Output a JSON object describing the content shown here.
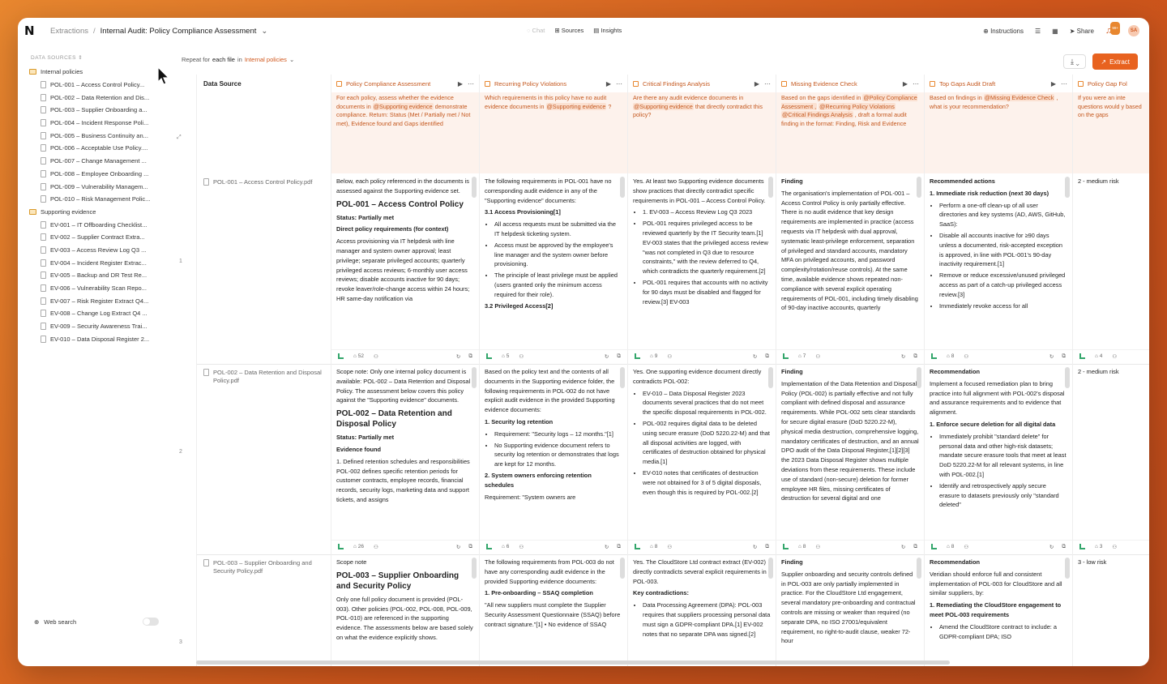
{
  "app": {
    "logo": "N"
  },
  "breadcrumb": {
    "root": "Extractions",
    "separator": "/",
    "current": "Internal Audit: Policy Compliance Assessment"
  },
  "center_nav": {
    "chat": "Chat",
    "sources": "Sources",
    "insights": "Insights"
  },
  "right_nav": {
    "instructions": "Instructions",
    "share": "Share",
    "notifications": "99+",
    "avatar": "SA"
  },
  "sidebar": {
    "heading": "DATA SOURCES",
    "folders": [
      {
        "name": "Internal policies",
        "files": [
          "POL-001 – Access Control Policy...",
          "POL-002 – Data Retention and Dis...",
          "POL-003 – Supplier Onboarding a...",
          "POL-004 – Incident Response Poli...",
          "POL-005 – Business Continuity an...",
          "POL-006 – Acceptable Use Policy....",
          "POL-007 – Change Management ...",
          "POL-008 – Employee Onboarding ...",
          "POL-009 – Vulnerability Managem...",
          "POL-010 – Risk Management Polic..."
        ]
      },
      {
        "name": "Supporting evidence",
        "files": [
          "EV-001 – IT Offboarding Checklist...",
          "EV-002 – Supplier Contract Extra...",
          "EV-003 – Access Review Log Q3 ...",
          "EV-004 – Incident Register Extrac...",
          "EV-005 – Backup and DR Test Re...",
          "EV-006 – Vulnerability Scan Repo...",
          "EV-007 – Risk Register Extract Q4...",
          "EV-008 – Change Log Extract Q4 ...",
          "EV-009 – Security Awareness Trai...",
          "EV-010 – Data Disposal Register 2..."
        ]
      }
    ],
    "web_search": "Web search"
  },
  "toolbar": {
    "repeat_prefix": "Repeat for",
    "repeat_mid": "each file",
    "repeat_in": "in",
    "repeat_target": "Internal policies",
    "extract": "Extract"
  },
  "table": {
    "ds_header": "Data Source",
    "columns": [
      {
        "title": "Policy Compliance Assessment",
        "prompt_pre": "For each policy, assess whether the evidence documents in ",
        "tags": [
          "@Supporting evidence"
        ],
        "prompt_post": " demonstrate compliance. Return: Status (Met / Partially met / Not met), Evidence found and Gaps identified"
      },
      {
        "title": "Recurring Policy Violations",
        "prompt_pre": "Which requirements in this policy have no audit evidence documents in ",
        "tags": [
          "@Supporting evidence"
        ],
        "prompt_post": " ?"
      },
      {
        "title": "Critical Findings Analysis",
        "prompt_pre": "Are there any audit evidence documents in ",
        "tags": [
          "@Supporting evidence"
        ],
        "prompt_post": " that directly contradict this policy?"
      },
      {
        "title": "Missing Evidence Check",
        "prompt_pre": "Based on the gaps identified in ",
        "tags": [
          "@Policy Compliance Assessment ,",
          "@Recurring Policy Violations",
          "@Critical Findings Analysis"
        ],
        "prompt_post": ", draft a formal audit finding in the format: Finding, Risk and Evidence"
      },
      {
        "title": "Top Gaps Audit Draft",
        "prompt_pre": "Based on findings in ",
        "tags": [
          "@Missing Evidence Check"
        ],
        "prompt_post": ", what is your recommendation?"
      },
      {
        "title": "Policy Gap Fol",
        "prompt_pre": "If you were an inte questions would y based on the gaps",
        "tags": [],
        "prompt_post": ""
      }
    ],
    "rows": [
      {
        "num": "1",
        "source": "POL-001 – Access Control Policy.pdf",
        "footer_counts": [
          "52",
          "5",
          "9",
          "7",
          "8",
          "4"
        ],
        "cells": [
          {
            "intro": "Below, each policy referenced in the documents is assessed against the Supporting evidence set.",
            "heading": "POL-001 – Access Control Policy",
            "status": "Status: Partially met",
            "sub": "Direct policy requirements (for context)",
            "body": "Access provisioning via IT helpdesk with line manager and system owner approval; least privilege; separate privileged accounts; quarterly privileged access reviews; 6-monthly user access reviews; disable accounts inactive for 90 days; revoke leaver/role-change access within 24 hours; HR same-day notification via"
          },
          {
            "intro": "The following requirements in POL-001 have no corresponding audit evidence in any of the \"Supporting evidence\" documents:",
            "sub": "3.1 Access Provisioning[1]",
            "items": [
              "All access requests must be submitted via the IT helpdesk ticketing system.",
              "Access must be approved by the employee's line manager and the system owner before provisioning.",
              "The principle of least privilege must be applied (users granted only the minimum access required for their role)."
            ],
            "tail": "3.2 Privileged Access[2]"
          },
          {
            "intro": "Yes. At least two Supporting evidence documents show practices that directly contradict specific requirements in POL-001 – Access Control Policy.",
            "items": [
              "1. EV-003 – Access Review Log Q3 2023",
              "POL-001 requires privileged access to be reviewed quarterly by the IT Security team.[1] EV-003 states that the privileged access review \"was not completed in Q3 due to resource constraints,\" with the review deferred to Q4, which contradicts the quarterly requirement.[2]",
              "POL-001 requires that accounts with no activity for 90 days must be disabled and flagged for review.[3] EV-003"
            ]
          },
          {
            "sub": "Finding",
            "body": "The organisation's implementation of POL-001 – Access Control Policy is only partially effective. There is no audit evidence that key design requirements are implemented in practice (access requests via IT helpdesk with dual approval, systematic least-privilege enforcement, separation of privileged and standard accounts, mandatory MFA on privileged accounts, and password complexity/rotation/reuse controls). At the same time, available evidence shows repeated non-compliance with several explicit operating requirements of POL-001, including timely disabling of 90-day inactive accounts, quarterly"
          },
          {
            "sub": "Recommended actions",
            "heading2": "1. Immediate risk reduction (next 30 days)",
            "items": [
              "Perform a one-off clean-up of all user directories and key systems (AD, AWS, GitHub, SaaS):",
              "Disable all accounts inactive for ≥90 days unless a documented, risk-accepted exception is approved, in line with POL-001's 90-day inactivity requirement.[1]",
              "Remove or reduce excessive/unused privileged access as part of a catch-up privileged access review.[3]",
              "Immediately revoke access for all"
            ]
          },
          {
            "body": "2 - medium risk"
          }
        ]
      },
      {
        "num": "2",
        "source": "POL-002 – Data Retention and Disposal Policy.pdf",
        "footer_counts": [
          "26",
          "6",
          "8",
          "8",
          "8",
          "3"
        ],
        "cells": [
          {
            "intro": "Scope note: Only one internal policy document is available: POL-002 – Data Retention and Disposal Policy. The assessment below covers this policy against the \"Supporting evidence\" documents.",
            "heading": "POL-002 – Data Retention and Disposal Policy",
            "status": "Status: Partially met",
            "sub": "Evidence found",
            "body": "1. Defined retention schedules and responsibilities POL-002 defines specific retention periods for customer contracts, employee records, financial records, security logs, marketing data and support tickets, and assigns"
          },
          {
            "intro": "Based on the policy text and the contents of all documents in the Supporting evidence folder, the following requirements in POL-002 do not have explicit audit evidence in the provided Supporting evidence documents:",
            "sub": "1. Security log retention",
            "items": [
              "Requirement: \"Security logs – 12 months.\"[1]",
              "No Supporting evidence document refers to security log retention or demonstrates that logs are kept for 12 months."
            ],
            "tail": "2. System owners enforcing retention schedules",
            "tail2": "Requirement: \"System owners are"
          },
          {
            "intro": "Yes. One supporting evidence document directly contradicts POL-002:",
            "items": [
              "EV-010 – Data Disposal Register 2023 documents several practices that do not meet the specific disposal requirements in POL-002.",
              "POL-002 requires digital data to be deleted using secure erasure (DoD 5220.22-M) and that all disposal activities are logged, with certificates of destruction obtained for physical media.[1]",
              "EV-010 notes that certificates of destruction were not obtained for 3 of 5 digital disposals, even though this is required by POL-002.[2]"
            ]
          },
          {
            "sub": "Finding",
            "body": "Implementation of the Data Retention and Disposal Policy (POL-002) is partially effective and not fully compliant with defined disposal and assurance requirements. While POL-002 sets clear standards for secure digital erasure (DoD 5220.22-M), physical media destruction, comprehensive logging, mandatory certificates of destruction, and an annual DPO audit of the Data Disposal Register,[1][2][3] the 2023 Data Disposal Register shows multiple deviations from these requirements. These include use of standard (non-secure) deletion for former employee HR files, missing certificates of destruction for several digital and one"
          },
          {
            "sub": "Recommendation",
            "body": "Implement a focused remediation plan to bring practice into full alignment with POL-002's disposal and assurance requirements and to evidence that alignment.",
            "heading2": "1. Enforce secure deletion for all digital data",
            "items": [
              "Immediately prohibit \"standard delete\" for personal data and other high-risk datasets; mandate secure erasure tools that meet at least DoD 5220.22-M for all relevant systems, in line with POL-002.[1]",
              "Identify and retrospectively apply secure erasure to datasets previously only \"standard deleted\""
            ]
          },
          {
            "body": "2 - medium risk"
          }
        ]
      },
      {
        "num": "3",
        "source": "POL-003 – Supplier Onboarding and Security Policy.pdf",
        "footer_counts": [],
        "cells": [
          {
            "intro": "Scope note",
            "body": "Only one full policy document is provided (POL-003). Other policies (POL-002, POL-008, POL-009, POL-010) are referenced in the supporting evidence. The assessments below are based solely on what the evidence explicitly shows.",
            "heading": "POL-003 – Supplier Onboarding and Security Policy"
          },
          {
            "intro": "The following requirements from POL-003 do not have any corresponding audit evidence in the provided Supporting evidence documents:",
            "sub": "1. Pre-onboarding – SSAQ completion",
            "body": "\"All new suppliers must complete the Supplier Security Assessment Questionnaire (SSAQ) before contract signature.\"[1] • No evidence of SSAQ"
          },
          {
            "intro": "Yes. The CloudStore Ltd contract extract (EV-002) directly contradicts several explicit requirements in POL-003.",
            "sub": "Key contradictions:",
            "items": [
              "Data Processing Agreement (DPA): POL-003 requires that suppliers processing personal data must sign a GDPR-compliant DPA.[1] EV-002 notes that no separate DPA was signed.[2]"
            ]
          },
          {
            "sub": "Finding",
            "body": "Supplier onboarding and security controls defined in POL-003 are only partially implemented in practice. For the CloudStore Ltd engagement, several mandatory pre-onboarding and contractual controls are missing or weaker than required (no separate DPA, no ISO 27001/equivalent requirement, no right-to-audit clause, weaker 72-hour"
          },
          {
            "sub": "Recommendation",
            "body": "Veridian should enforce full and consistent implementation of POL-003 for CloudStore and all similar suppliers, by:",
            "heading2": "1. Remediating the CloudStore engagement to meet POL-003 requirements",
            "items": [
              "Amend the CloudStore contract to include: a GDPR-compliant DPA; ISO"
            ]
          },
          {
            "body": "3 - low risk"
          }
        ]
      }
    ]
  }
}
